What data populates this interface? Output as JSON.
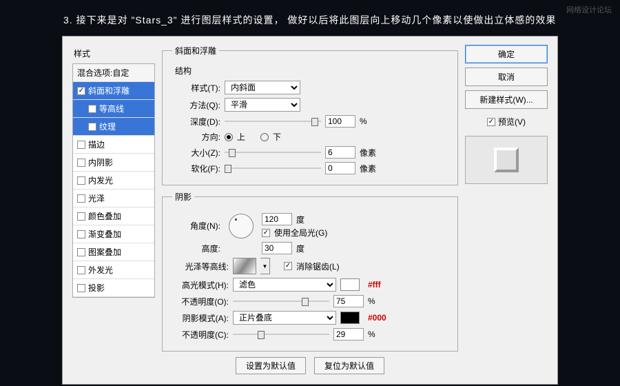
{
  "instruction": "3. 接下来是对 \"Stars_3\" 进行图层样式的设置，  做好以后将此图层向上移动几个像素以使做出立体感的效果",
  "watermark": "网络设计论坛",
  "left": {
    "title": "样式",
    "blend": "混合选项:自定",
    "bevel": "斜面和浮雕",
    "contour": "等高线",
    "texture": "纹理",
    "stroke": "描边",
    "innerShadow": "内阴影",
    "innerGlow": "内发光",
    "satin": "光泽",
    "colorOverlay": "颜色叠加",
    "gradOverlay": "渐变叠加",
    "patOverlay": "图案叠加",
    "outerGlow": "外发光",
    "dropShadow": "投影"
  },
  "panel": {
    "title": "斜面和浮雕",
    "structTitle": "结构",
    "styleLbl": "样式(T):",
    "styleVal": "内斜面",
    "techLbl": "方法(Q):",
    "techVal": "平滑",
    "depthLbl": "深度(D):",
    "depthVal": "100",
    "pct": "%",
    "dirLbl": "方向:",
    "up": "上",
    "down": "下",
    "sizeLbl": "大小(Z):",
    "sizeVal": "6",
    "px": "像素",
    "softLbl": "软化(F):",
    "softVal": "0",
    "shadeTitle": "阴影",
    "angleLbl": "角度(N):",
    "angleVal": "120",
    "deg": "度",
    "globalLight": "使用全局光(G)",
    "altLbl": "高度:",
    "altVal": "30",
    "glossLbl": "光泽等高线:",
    "antiAlias": "消除锯齿(L)",
    "hlModeLbl": "高光模式(H):",
    "hlModeVal": "滤色",
    "hlHex": "#fff",
    "hlOpLbl": "不透明度(O):",
    "hlOpVal": "75",
    "shModeLbl": "阴影模式(A):",
    "shModeVal": "正片叠底",
    "shHex": "#000",
    "shOpLbl": "不透明度(C):",
    "shOpVal": "29",
    "setDefault": "设置为默认值",
    "resetDefault": "复位为默认值"
  },
  "right": {
    "ok": "确定",
    "cancel": "取消",
    "newStyle": "新建样式(W)...",
    "preview": "预览(V)"
  }
}
